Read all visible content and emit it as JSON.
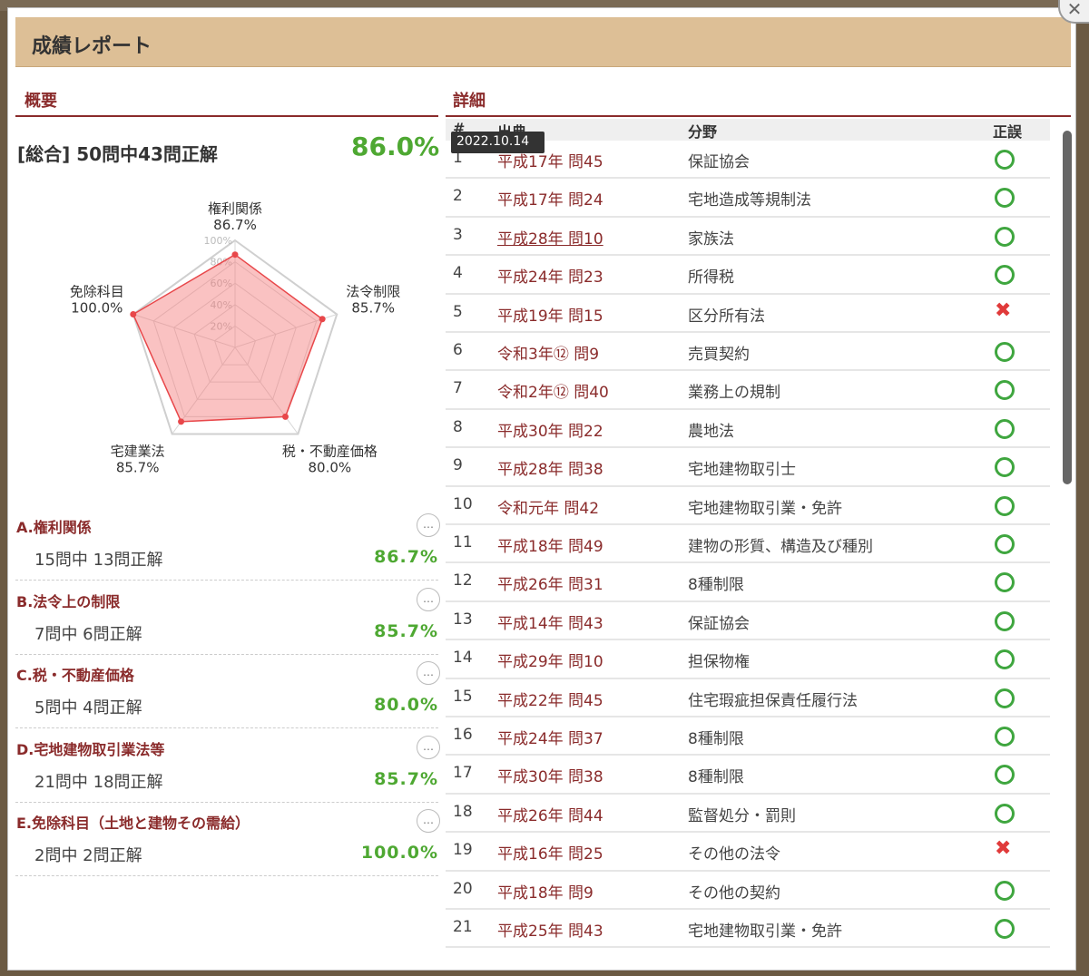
{
  "modal": {
    "title": "成績レポート",
    "close_icon": "close-icon"
  },
  "summary": {
    "title": "概要",
    "total_text": "[総合] 50問中43問正解",
    "total_pct": "86.0%",
    "radar": {
      "axes": [
        {
          "label": "権利関係",
          "value_label": "86.7%",
          "value": 86.7
        },
        {
          "label": "法令制限",
          "value_label": "85.7%",
          "value": 85.7
        },
        {
          "label": "税・不動産価格",
          "value_label": "80.0%",
          "value": 80.0
        },
        {
          "label": "宅建業法",
          "value_label": "85.7%",
          "value": 85.7
        },
        {
          "label": "免除科目",
          "value_label": "100.0%",
          "value": 100.0
        }
      ],
      "ticks": [
        "20%",
        "40%",
        "60%",
        "80%",
        "100%"
      ]
    },
    "categories": [
      {
        "name": "A.権利関係",
        "count": "15問中 13問正解",
        "pct": "86.7%"
      },
      {
        "name": "B.法令上の制限",
        "count": "7問中 6問正解",
        "pct": "85.7%"
      },
      {
        "name": "C.税・不動産価格",
        "count": "5問中 4問正解",
        "pct": "80.0%"
      },
      {
        "name": "D.宅地建物取引業法等",
        "count": "21問中 18問正解",
        "pct": "85.7%"
      },
      {
        "name": "E.免除科目（土地と建物その需給）",
        "count": "2問中 2問正解",
        "pct": "100.0%"
      }
    ],
    "more_label": "…"
  },
  "detail": {
    "title": "詳細",
    "columns": {
      "num": "#",
      "source": "出典",
      "field": "分野",
      "result": "正誤"
    },
    "tooltip": "2022.10.14",
    "rows": [
      {
        "num": "1",
        "source": "平成17年 問45",
        "field": "保証協会",
        "ok": true
      },
      {
        "num": "2",
        "source": "平成17年 問24",
        "field": "宅地造成等規制法",
        "ok": true
      },
      {
        "num": "3",
        "source": "平成28年 問10",
        "field": "家族法",
        "ok": true
      },
      {
        "num": "4",
        "source": "平成24年 問23",
        "field": "所得税",
        "ok": true
      },
      {
        "num": "5",
        "source": "平成19年 問15",
        "field": "区分所有法",
        "ok": false
      },
      {
        "num": "6",
        "source": "令和3年⑫ 問9",
        "field": "売買契約",
        "ok": true
      },
      {
        "num": "7",
        "source": "令和2年⑫ 問40",
        "field": "業務上の規制",
        "ok": true
      },
      {
        "num": "8",
        "source": "平成30年 問22",
        "field": "農地法",
        "ok": true
      },
      {
        "num": "9",
        "source": "平成28年 問38",
        "field": "宅地建物取引士",
        "ok": true
      },
      {
        "num": "10",
        "source": "令和元年 問42",
        "field": "宅地建物取引業・免許",
        "ok": true
      },
      {
        "num": "11",
        "source": "平成18年 問49",
        "field": "建物の形質、構造及び種別",
        "ok": true
      },
      {
        "num": "12",
        "source": "平成26年 問31",
        "field": "8種制限",
        "ok": true
      },
      {
        "num": "13",
        "source": "平成14年 問43",
        "field": "保証協会",
        "ok": true
      },
      {
        "num": "14",
        "source": "平成29年 問10",
        "field": "担保物権",
        "ok": true
      },
      {
        "num": "15",
        "source": "平成22年 問45",
        "field": "住宅瑕疵担保責任履行法",
        "ok": true
      },
      {
        "num": "16",
        "source": "平成24年 問37",
        "field": "8種制限",
        "ok": true
      },
      {
        "num": "17",
        "source": "平成30年 問38",
        "field": "8種制限",
        "ok": true
      },
      {
        "num": "18",
        "source": "平成26年 問44",
        "field": "監督処分・罰則",
        "ok": true
      },
      {
        "num": "19",
        "source": "平成16年 問25",
        "field": "その他の法令",
        "ok": false
      },
      {
        "num": "20",
        "source": "平成18年 問9",
        "field": "その他の契約",
        "ok": true
      },
      {
        "num": "21",
        "source": "平成25年 問43",
        "field": "宅地建物取引業・免許",
        "ok": true
      }
    ]
  },
  "colors": {
    "brand": "#8a2b2b",
    "ok": "#3fa63f",
    "ng": "#e03a3a",
    "header_bg": "#ddbf96",
    "pct": "#4ea832"
  }
}
